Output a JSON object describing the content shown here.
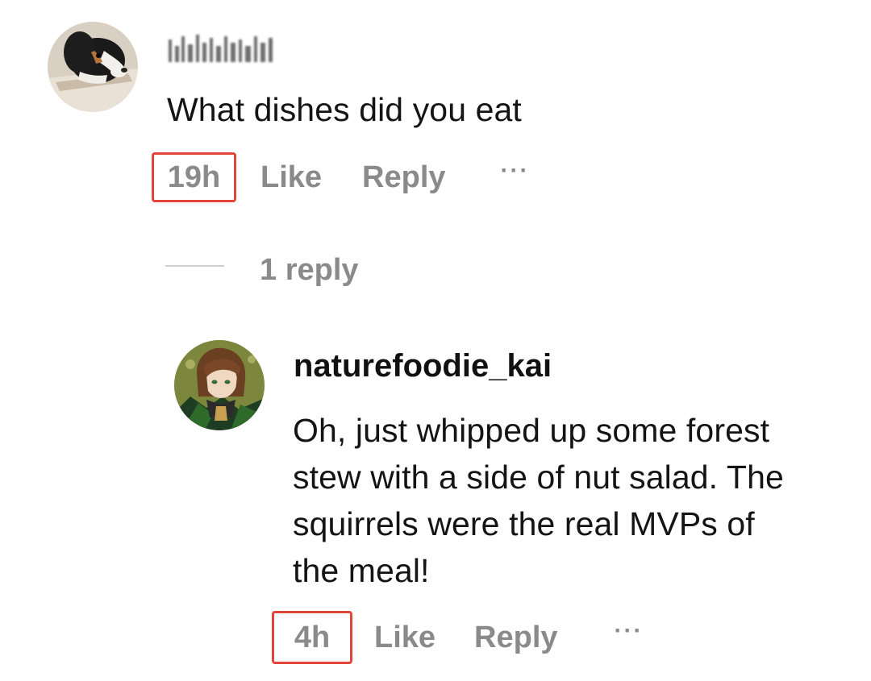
{
  "top_comment": {
    "avatar": "dog-photo-avatar",
    "username_blurred": true,
    "text": "What dishes did you eat",
    "time": "19h",
    "like_label": "Like",
    "reply_label": "Reply",
    "more_label": "···"
  },
  "replies_toggle": {
    "label": "1 reply"
  },
  "reply": {
    "avatar": "anime-character-avatar",
    "username": "naturefoodie_kai",
    "text": "Oh, just whipped up some forest stew with a side of nut salad. The squirrels were the real MVPs of the meal!",
    "time": "4h",
    "like_label": "Like",
    "reply_label": "Reply",
    "more_label": "···"
  },
  "colors": {
    "highlight_box": "#e0473a",
    "secondary_text": "#8a8a8a",
    "primary_text": "#111111"
  }
}
